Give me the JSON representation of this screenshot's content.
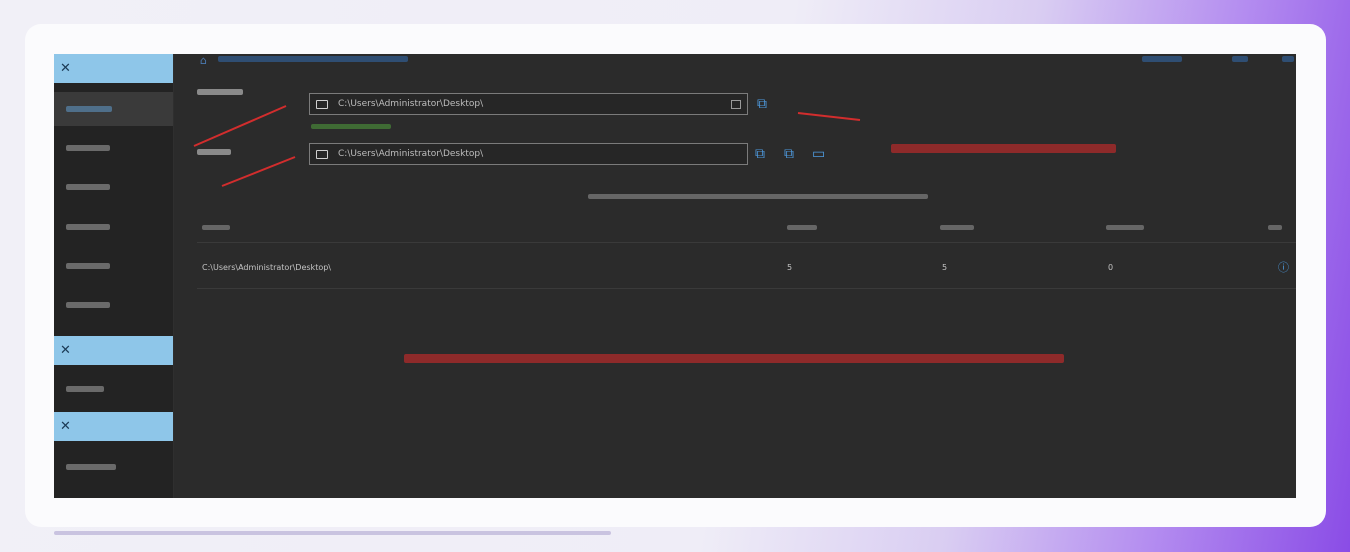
{
  "sidebar": {
    "groups": [
      {
        "label": "",
        "items": [
          {
            "label": "",
            "active": true
          },
          {
            "label": "",
            "active": false
          },
          {
            "label": "",
            "active": false
          },
          {
            "label": "",
            "active": false
          },
          {
            "label": "",
            "active": false
          },
          {
            "label": "",
            "active": false
          }
        ]
      },
      {
        "label": "",
        "items": [
          {
            "label": "",
            "active": false
          }
        ]
      },
      {
        "label": "",
        "items": [
          {
            "label": "",
            "active": false
          }
        ]
      }
    ]
  },
  "breadcrumb": {
    "home_icon": "home-icon",
    "text": ""
  },
  "header_right": {
    "links": [
      "",
      "",
      ""
    ]
  },
  "form": {
    "source": {
      "label": "",
      "path": "C:\\Users\\Administrator\\Desktop\\",
      "hint": ""
    },
    "output": {
      "label": "",
      "path": "C:\\Users\\Administrator\\Desktop\\"
    }
  },
  "notes": {
    "right_note": "",
    "center_note": ""
  },
  "summary_text": "",
  "table": {
    "columns": [
      "",
      "",
      "",
      "",
      ""
    ],
    "rows": [
      {
        "path": "C:\\Users\\Administrator\\Desktop\\",
        "c1": "5",
        "c2": "5",
        "c3": "0",
        "action_icon": "info-icon"
      }
    ]
  },
  "colors": {
    "accent": "#4e9be0",
    "sidebar_head": "#8ec6e9",
    "note_red": "#d22d2d",
    "hint_green": "#6aa84f",
    "panel_bg": "#2b2b2b"
  }
}
